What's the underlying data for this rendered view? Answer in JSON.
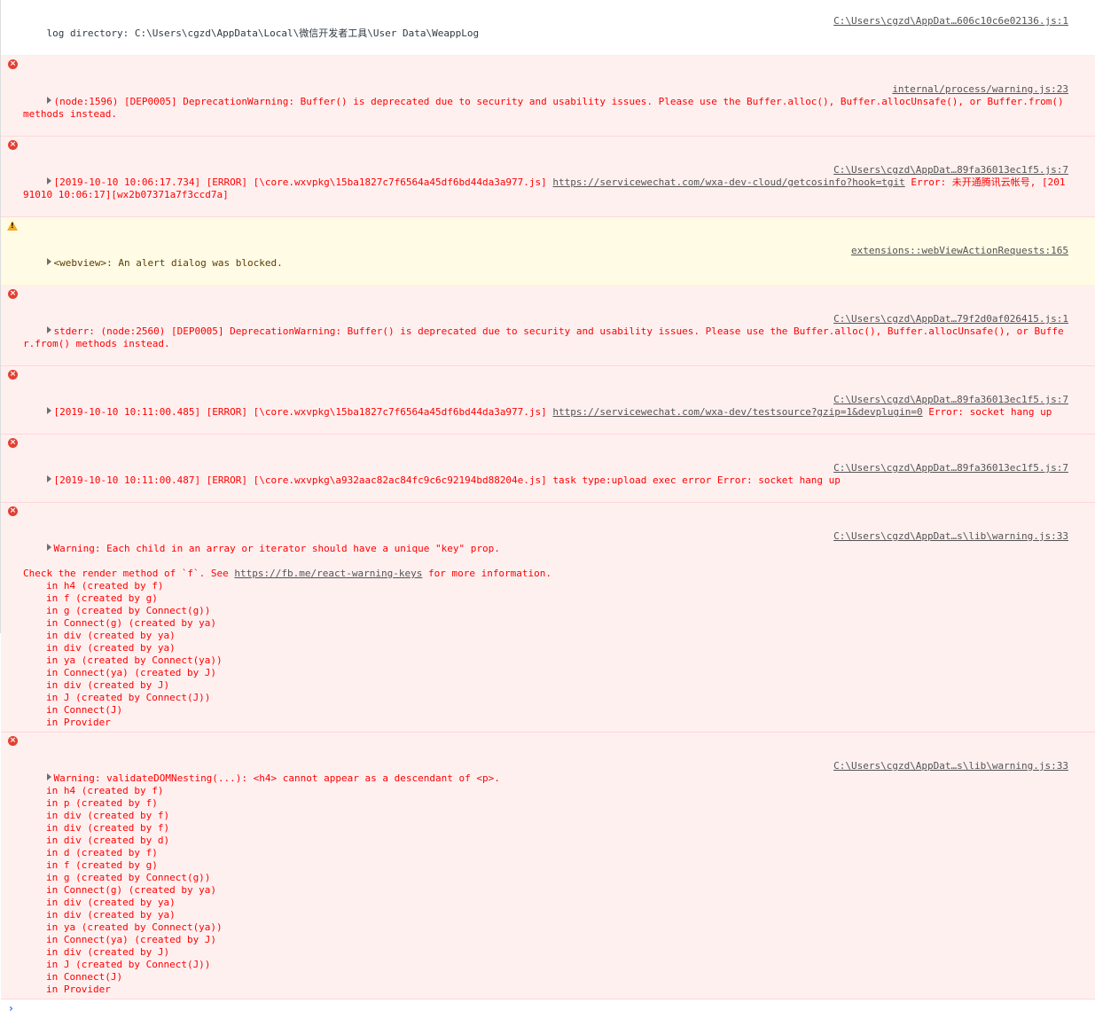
{
  "messages": [
    {
      "level": "log",
      "text": "log directory: C:\\Users\\cgzd\\AppData\\Local\\微信开发者工具\\User Data\\WeappLog",
      "source": "C:\\Users\\cgzd\\AppDat…606c10c6e02136.js:1"
    },
    {
      "level": "error",
      "text": "(node:1596) [DEP0005] DeprecationWarning: Buffer() is deprecated due to security and usability issues. Please use the Buffer.alloc(), Buffer.allocUnsafe(), or Buffer.from() methods instead.",
      "source": "internal/process/warning.js:23"
    },
    {
      "level": "error",
      "text_pre": "[2019-10-10 10:06:17.734] [ERROR] [\\core.wxvpkg\\15ba1827c7f6564a45df6bd44da3a977.js] ",
      "link": "https://servicewechat.com/wxa-dev-cloud/getcosinfo?hook=tgit",
      "text_post": " Error: 未开通腾讯云帐号, [20191010 10:06:17][wx2b07371a7f3ccd7a]",
      "source": "C:\\Users\\cgzd\\AppDat…89fa36013ec1f5.js:7"
    },
    {
      "level": "warn",
      "text": "<webview>: An alert dialog was blocked.",
      "source": "extensions::webViewActionRequests:165"
    },
    {
      "level": "error",
      "text": "stderr: (node:2560) [DEP0005] DeprecationWarning: Buffer() is deprecated due to security and usability issues. Please use the Buffer.alloc(), Buffer.allocUnsafe(), or Buffer.from() methods instead.",
      "source": "C:\\Users\\cgzd\\AppDat…79f2d0af026415.js:1"
    },
    {
      "level": "error",
      "text_pre": "[2019-10-10 10:11:00.485] [ERROR] [\\core.wxvpkg\\15ba1827c7f6564a45df6bd44da3a977.js] ",
      "link": "https://servicewechat.com/wxa-dev/testsource?gzip=1&devplugin=0",
      "text_post": " Error: socket hang up",
      "source": "C:\\Users\\cgzd\\AppDat…89fa36013ec1f5.js:7"
    },
    {
      "level": "error",
      "text": "[2019-10-10 10:11:00.487] [ERROR] [\\core.wxvpkg\\a932aac82ac84fc9c6c92194bd88204e.js] task type:upload exec error Error: socket hang up",
      "source": "C:\\Users\\cgzd\\AppDat…89fa36013ec1f5.js:7"
    }
  ],
  "warning_keys": {
    "text": "Warning: Each child in an array or iterator should have a unique \"key\" prop.",
    "check_pre": "Check the render method of `f`. See ",
    "check_link": "https://fb.me/react-warning-keys",
    "check_post": " for more information.",
    "stack": "in h4 (created by f)\nin f (created by g)\nin g (created by Connect(g))\nin Connect(g) (created by ya)\nin div (created by ya)\nin div (created by ya)\nin ya (created by Connect(ya))\nin Connect(ya) (created by J)\nin div (created by J)\nin J (created by Connect(J))\nin Connect(J)\nin Provider",
    "source": "C:\\Users\\cgzd\\AppDat…s\\lib\\warning.js:33"
  },
  "warning_nesting": {
    "text": "Warning: validateDOMNesting(...): <h4> cannot appear as a descendant of <p>.",
    "stack": "in h4 (created by f)\nin p (created by f)\nin div (created by f)\nin div (created by f)\nin div (created by d)\nin d (created by f)\nin f (created by g)\nin g (created by Connect(g))\nin Connect(g) (created by ya)\nin div (created by ya)\nin div (created by ya)\nin ya (created by Connect(ya))\nin Connect(ya) (created by J)\nin div (created by J)\nin J (created by Connect(J))\nin Connect(J)\nin Provider",
    "source": "C:\\Users\\cgzd\\AppDat…s\\lib\\warning.js:33"
  },
  "prompt": {
    "symbol": "›",
    "value": ""
  },
  "colors": {
    "error_bg": "#fff0f0",
    "error_text": "#ff0000",
    "warn_bg": "#fffbe5",
    "prompt_accent": "#367cf1"
  }
}
